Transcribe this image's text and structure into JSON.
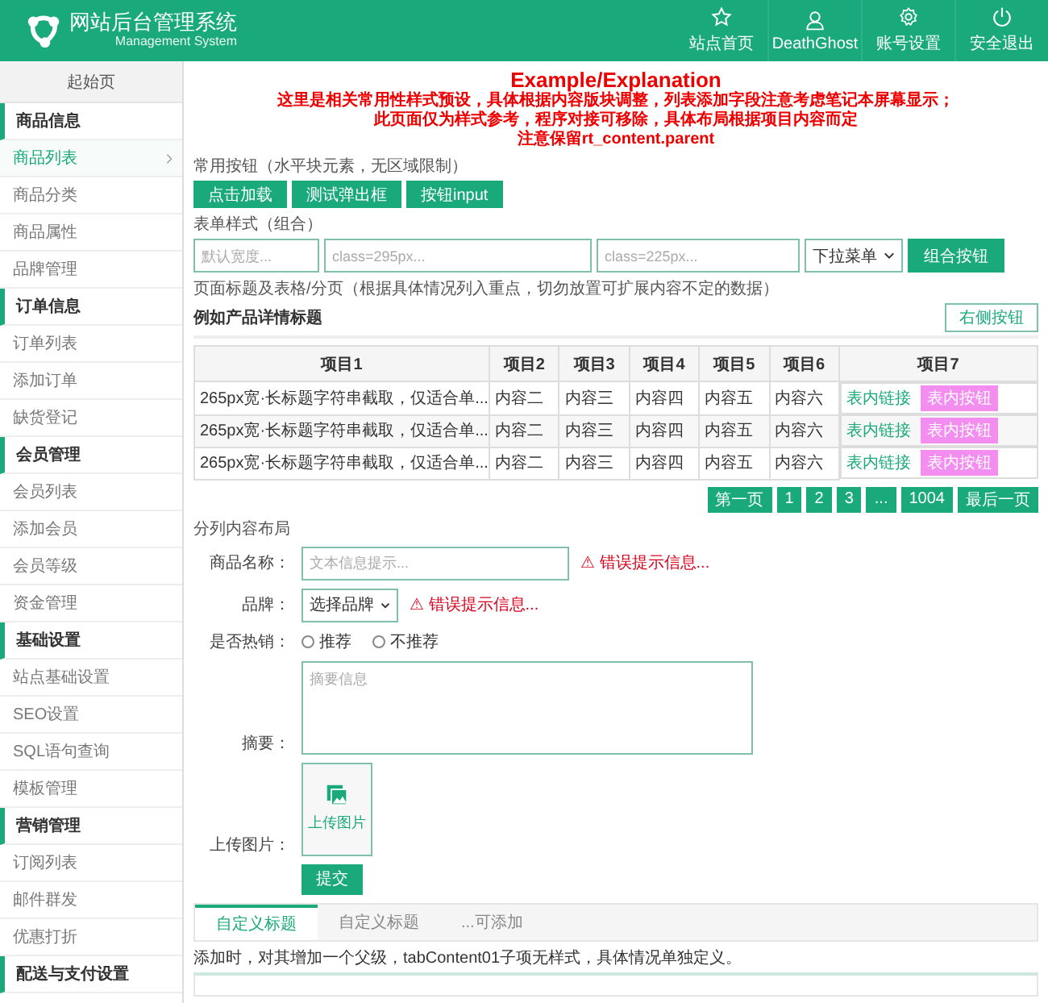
{
  "header": {
    "title": "网站后台管理系统",
    "subtitle": "Management System",
    "nav": [
      {
        "label": "站点首页"
      },
      {
        "label": "DeathGhost"
      },
      {
        "label": "账号设置"
      },
      {
        "label": "安全退出"
      }
    ]
  },
  "sidebar": {
    "home": "起始页",
    "groups": [
      {
        "title": "商品信息",
        "items": [
          {
            "label": "商品列表",
            "selected": true
          },
          {
            "label": "商品分类",
            "selected": false
          },
          {
            "label": "商品属性",
            "selected": false
          },
          {
            "label": "品牌管理",
            "selected": false
          }
        ]
      },
      {
        "title": "订单信息",
        "items": [
          {
            "label": "订单列表",
            "selected": false
          },
          {
            "label": "添加订单",
            "selected": false
          },
          {
            "label": "缺货登记",
            "selected": false
          }
        ]
      },
      {
        "title": "会员管理",
        "items": [
          {
            "label": "会员列表",
            "selected": false
          },
          {
            "label": "添加会员",
            "selected": false
          },
          {
            "label": "会员等级",
            "selected": false
          },
          {
            "label": "资金管理",
            "selected": false
          }
        ]
      },
      {
        "title": "基础设置",
        "items": [
          {
            "label": "站点基础设置",
            "selected": false
          },
          {
            "label": "SEO设置",
            "selected": false
          },
          {
            "label": "SQL语句查询",
            "selected": false
          },
          {
            "label": "模板管理",
            "selected": false
          }
        ]
      },
      {
        "title": "营销管理",
        "items": [
          {
            "label": "订阅列表",
            "selected": false
          },
          {
            "label": "邮件群发",
            "selected": false
          },
          {
            "label": "优惠打折",
            "selected": false
          }
        ]
      },
      {
        "title": "配送与支付设置"
      }
    ]
  },
  "notice": {
    "title": "Example/Explanation",
    "lines": [
      "这里是相关常用性样式预设，具体根据内容版块调整，列表添加字段注意考虑笔记本屏幕显示；",
      "此页面仅为样式参考，程序对接可移除，具体布局根据项目内容而定",
      "注意保留rt_content.parent"
    ]
  },
  "buttons_section": {
    "label": "常用按钮（水平块元素，无区域限制）",
    "buttons": [
      "点击加载",
      "测试弹出框",
      "按钮input"
    ]
  },
  "form_group": {
    "label": "表单样式（组合）",
    "inputs": [
      {
        "placeholder": "默认宽度..."
      },
      {
        "placeholder": "class=295px..."
      },
      {
        "placeholder": "class=225px..."
      }
    ],
    "select": "下拉菜单",
    "button": "组合按钮"
  },
  "table_section": {
    "label": "页面标题及表格/分页（根据具体情况列入重点，切勿放置可扩展内容不定的数据）",
    "title": "例如产品详情标题",
    "right_button": "右侧按钮",
    "columns": [
      "项目1",
      "项目2",
      "项目3",
      "项目4",
      "项目5",
      "项目6",
      "项目7"
    ],
    "rows": [
      {
        "cells": [
          "265px宽·长标题字符串截取，仅适合单...",
          "内容二",
          "内容三",
          "内容四",
          "内容五",
          "内容六"
        ],
        "link": "表内链接",
        "button": "表内按钮"
      },
      {
        "cells": [
          "265px宽·长标题字符串截取，仅适合单...",
          "内容二",
          "内容三",
          "内容四",
          "内容五",
          "内容六"
        ],
        "link": "表内链接",
        "button": "表内按钮"
      },
      {
        "cells": [
          "265px宽·长标题字符串截取，仅适合单...",
          "内容二",
          "内容三",
          "内容四",
          "内容五",
          "内容六"
        ],
        "link": "表内链接",
        "button": "表内按钮"
      }
    ],
    "pagination": [
      "第一页",
      "1",
      "2",
      "3",
      "...",
      "1004",
      "最后一页"
    ]
  },
  "layout_section": {
    "title": "分列内容布局",
    "fields": [
      {
        "kind": "text",
        "label": "商品名称：",
        "placeholder": "文本信息提示...",
        "error": "⚠ 错误提示信息..."
      },
      {
        "kind": "select",
        "label": "品牌：",
        "value": "选择品牌",
        "error": "⚠ 错误提示信息..."
      },
      {
        "kind": "radio",
        "label": "是否热销：",
        "options": [
          {
            "label": "推荐",
            "selected": false
          },
          {
            "label": "不推荐",
            "selected": false
          }
        ]
      },
      {
        "kind": "textarea",
        "label": "摘要：",
        "placeholder": "摘要信息"
      },
      {
        "kind": "upload",
        "label": "上传图片：",
        "button": "上传图片"
      },
      {
        "kind": "submit",
        "button": "提交"
      }
    ]
  },
  "tabs": [
    {
      "label": "自定义标题",
      "selected": true
    },
    {
      "label": "自定义标题",
      "selected": false
    },
    {
      "label": "...可添加",
      "selected": false
    }
  ],
  "tab_note": "添加时，对其增加一个父级，tabContent01子项无样式，具体情况单独定义。"
}
